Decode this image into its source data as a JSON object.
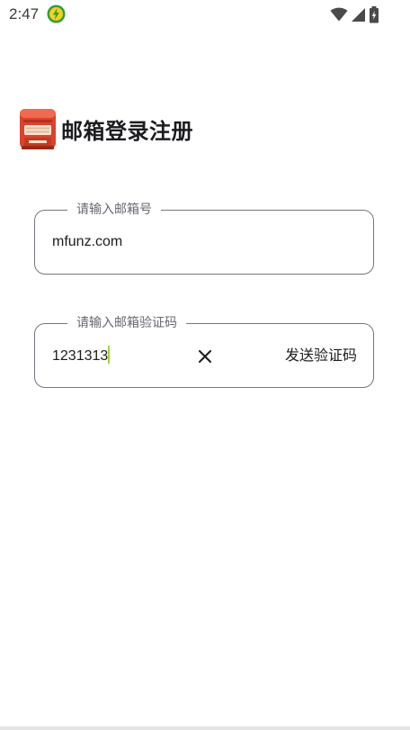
{
  "status_bar": {
    "time": "2:47",
    "app_icon": "lightning-app-icon",
    "icons": [
      "wifi-icon",
      "cellular-signal-icon",
      "battery-icon"
    ]
  },
  "header": {
    "icon": "mailbox-icon",
    "title": "邮箱登录注册"
  },
  "email_field": {
    "label": "请输入邮箱号",
    "value": "mfunz.com"
  },
  "code_field": {
    "label": "请输入邮箱验证码",
    "value": "1231313",
    "clear_icon": "close-icon",
    "send_button_label": "发送验证码"
  },
  "colors": {
    "outline": "#79747e",
    "label": "#6a6670",
    "text": "#1c1b1f",
    "caret": "#a6d33c",
    "mailbox_red": "#d9432c"
  }
}
